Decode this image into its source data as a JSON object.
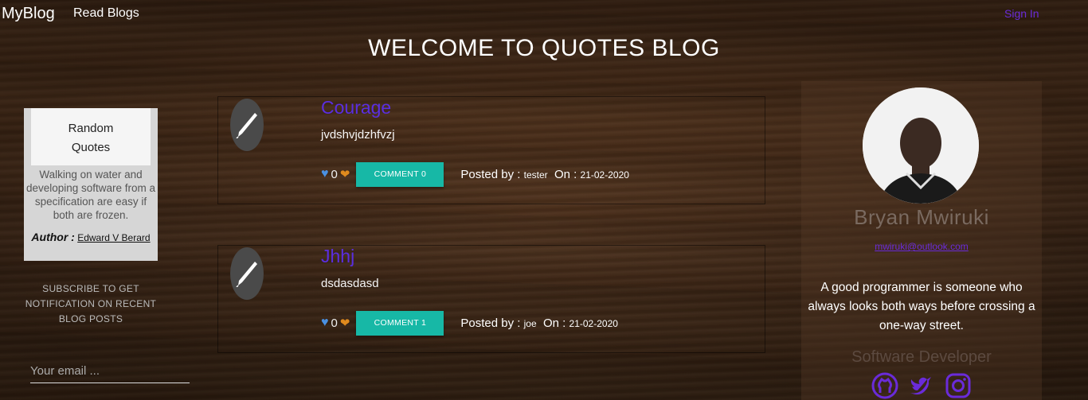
{
  "nav": {
    "brand": "MyBlog",
    "read_blogs": "Read Blogs",
    "sign_in": "Sign In"
  },
  "page_title": "WELCOME TO QUOTES BLOG",
  "random_quote": {
    "heading_line1": "Random",
    "heading_line2": "Quotes",
    "text": "Walking on water and developing software from a specification are easy if both are frozen.",
    "author_label": "Author :",
    "author_name": "Edward V Berard"
  },
  "subscribe": {
    "line1": "SUBSCRIBE TO GET",
    "line2": "NOTIFICATION ON RECENT",
    "line3": "BLOG POSTS",
    "email_placeholder": "Your email ..."
  },
  "posts": [
    {
      "title": "Courage",
      "body": "jvdshvjdzhfvzj",
      "likes": "0",
      "comment_button": "COMMENT 0",
      "posted_by_label": "Posted by :",
      "author": "tester",
      "on_label": "On :",
      "date": "21-02-2020"
    },
    {
      "title": "Jhhj",
      "body": "dsdasdasd",
      "likes": "0",
      "comment_button": "COMMENT 1",
      "posted_by_label": "Posted by :",
      "author": "joe",
      "on_label": "On :",
      "date": "21-02-2020"
    }
  ],
  "profile": {
    "name": "Bryan Mwiruki",
    "email": "mwiruki@outlook.com",
    "quote": "A good programmer is someone who always looks both ways before crossing a one-way street.",
    "role": "Software Developer",
    "socials": [
      "github-icon",
      "twitter-icon",
      "instagram-icon"
    ]
  },
  "colors": {
    "accent": "#6a2bd9",
    "comment_button": "#17b8a6",
    "like_heart": "#4a90e2",
    "pulse_heart": "#e08a1e"
  }
}
